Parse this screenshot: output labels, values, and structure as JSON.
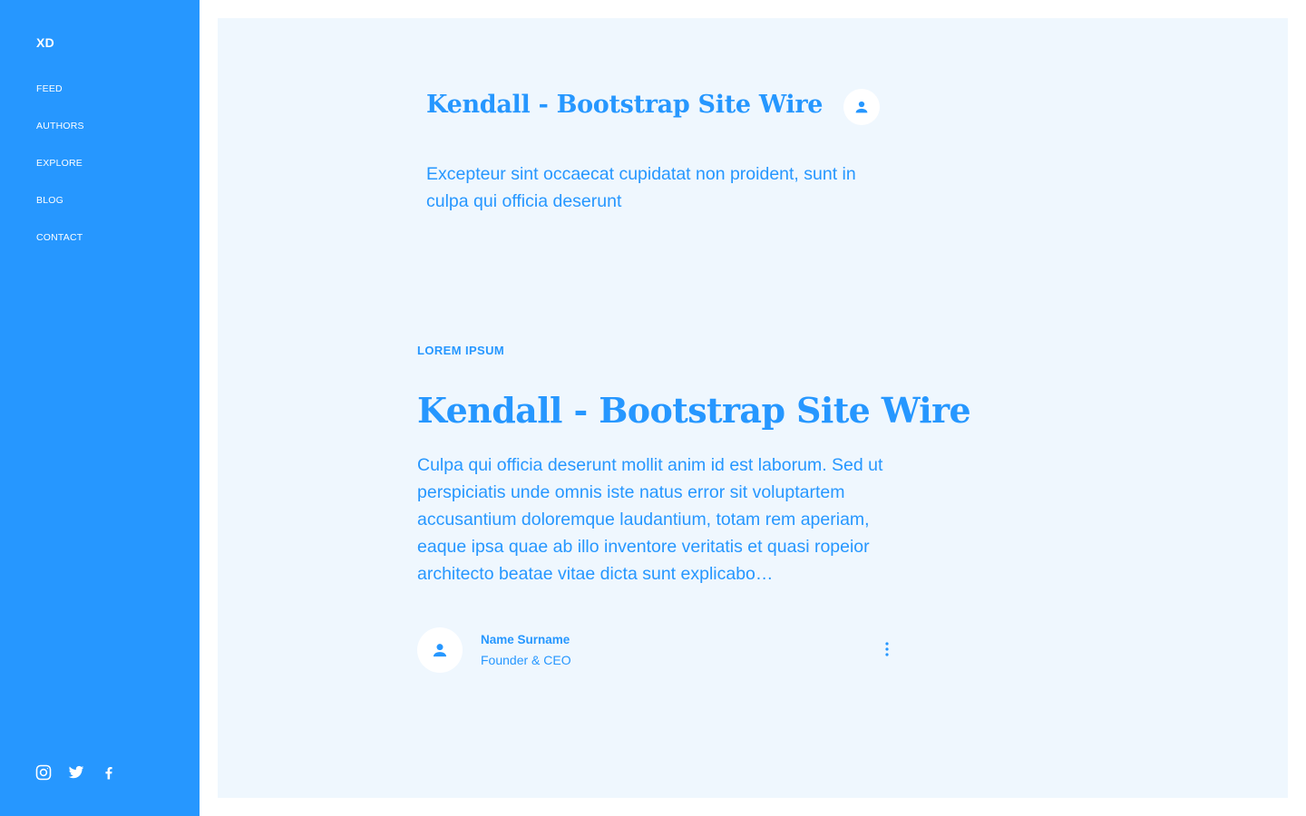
{
  "sidebar": {
    "brand": "XD",
    "nav": [
      "FEED",
      "AUTHORS",
      "EXPLORE",
      "BLOG",
      "CONTACT"
    ],
    "socials": [
      "instagram-icon",
      "twitter-icon",
      "facebook-icon"
    ]
  },
  "hero": {
    "title": "Kendall - Bootstrap Site Wire",
    "text": "Excepteur sint occaecat cupidatat non proident, sunt in culpa qui officia deserunt",
    "avatar_icon": "user-icon"
  },
  "article": {
    "kicker": "LOREM IPSUM",
    "title": "Kendall - Bootstrap Site Wire",
    "body": "Culpa qui officia deserunt mollit anim id est laborum. Sed ut perspiciatis unde omnis iste natus error sit voluptartem accusantium doloremque laudantium, totam rem aperiam, eaque ipsa quae ab illo inventore veritatis et quasi ropeior architecto beatae vitae dicta sunt explicabo…",
    "author": {
      "name": "Name Surname",
      "role": "Founder & CEO",
      "avatar_icon": "user-icon"
    },
    "more_icon": "more-vertical-icon"
  },
  "colors": {
    "accent": "#2697ff",
    "sidebar_bg": "#2697ff",
    "main_bg": "#eff7fe",
    "page_bg": "#ffffff"
  }
}
